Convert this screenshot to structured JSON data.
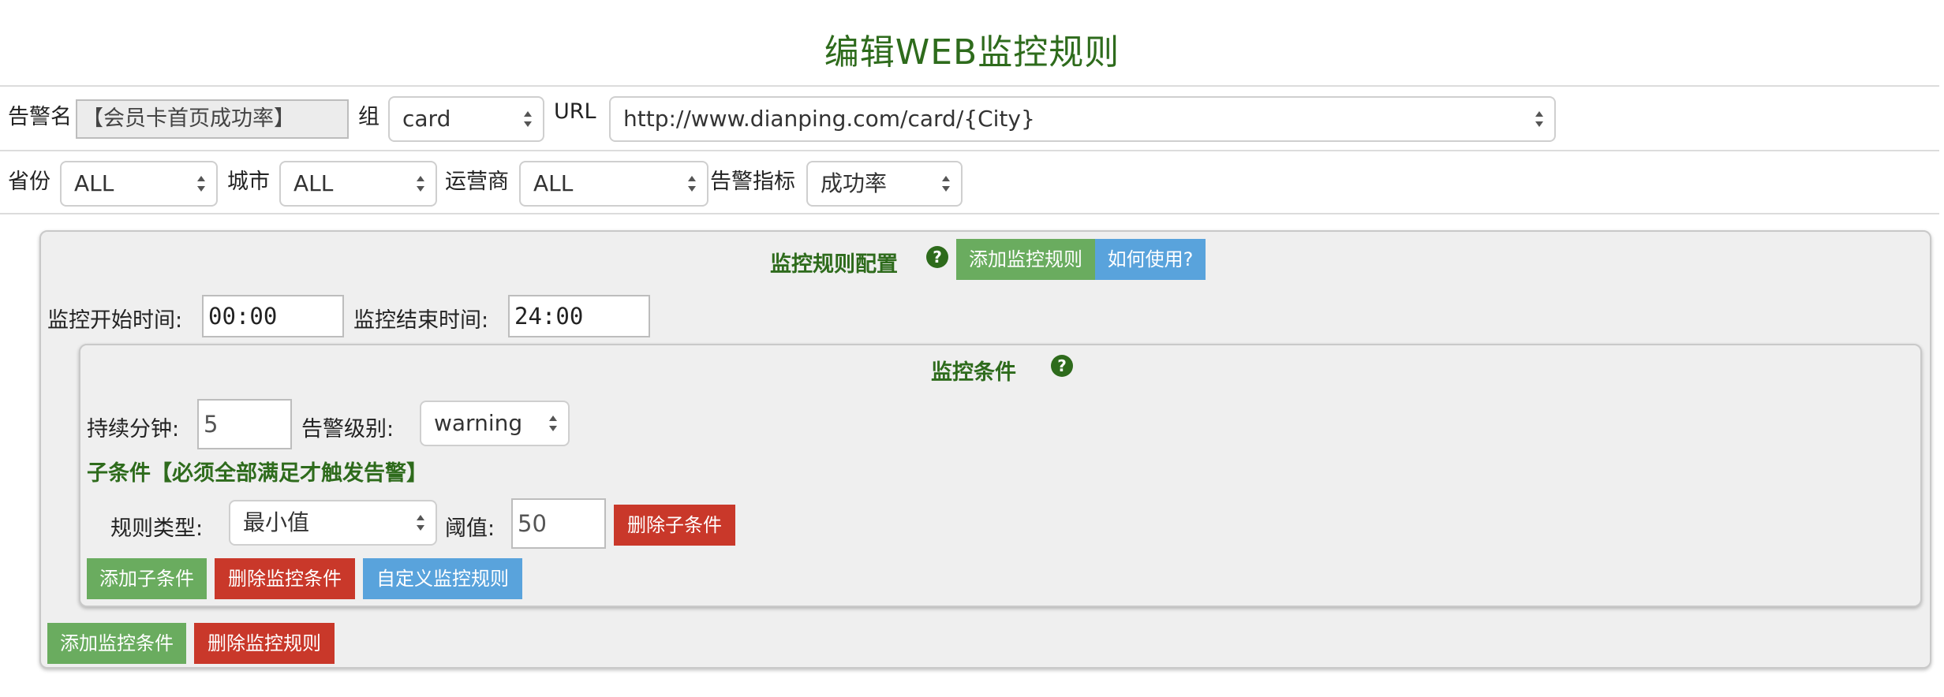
{
  "page": {
    "title": "编辑WEB监控规则"
  },
  "filters_row1": {
    "alert_name_label": "告警名",
    "alert_name_value": "【会员卡首页成功率】",
    "group_label": "组",
    "group_value": "card",
    "url_label": "URL",
    "url_value": "http://www.dianping.com/card/{City}"
  },
  "filters_row2": {
    "province_label": "省份",
    "province_value": "ALL",
    "city_label": "城市",
    "city_value": "ALL",
    "carrier_label": "运营商",
    "carrier_value": "ALL",
    "metric_label": "告警指标",
    "metric_value": "成功率"
  },
  "rule_config": {
    "title": "监控规则配置",
    "help_icon": "?",
    "add_rule_button": "添加监控规则",
    "how_to_button": "如何使用?",
    "start_time_label": "监控开始时间:",
    "start_time_value": "00:00",
    "end_time_label": "监控结束时间:",
    "end_time_value": "24:00",
    "add_condition_button": "添加监控条件",
    "delete_rule_button": "删除监控规则"
  },
  "condition": {
    "title": "监控条件",
    "help_icon": "?",
    "duration_label": "持续分钟:",
    "duration_value": "5",
    "level_label": "告警级别:",
    "level_value": "warning",
    "subcondition_title": "子条件【必须全部满足才触发告警】",
    "rule_type_label": "规则类型:",
    "rule_type_value": "最小值",
    "threshold_label": "阈值:",
    "threshold_value": "50",
    "delete_subcondition_button": "删除子条件",
    "add_subcondition_button": "添加子条件",
    "delete_condition_button": "删除监控条件",
    "custom_rule_button": "自定义监控规则"
  },
  "colors": {
    "title_green": "#2e6b1c",
    "button_green": "#6aac5f",
    "button_red": "#c9382a",
    "button_blue": "#59a3dc",
    "panel_bg": "#efefef"
  }
}
